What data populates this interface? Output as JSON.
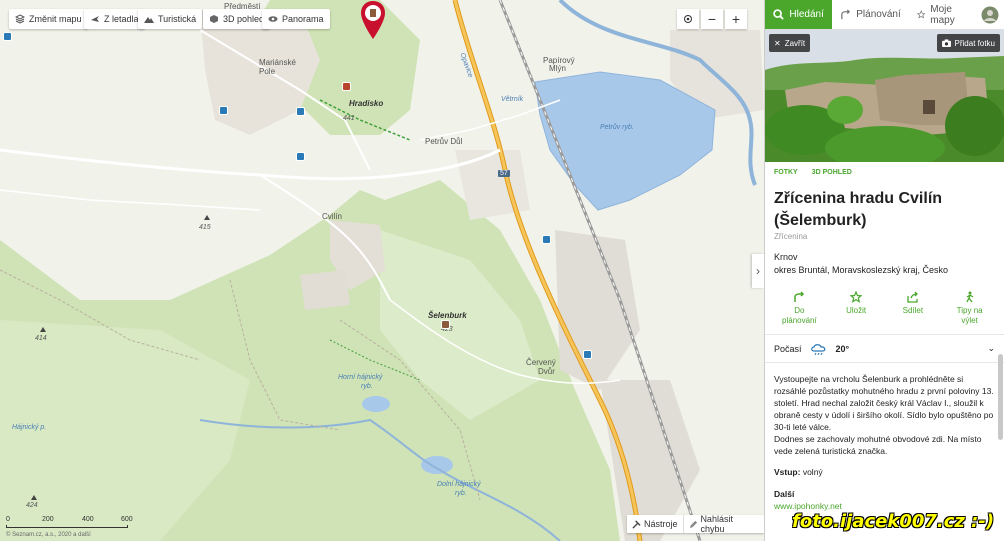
{
  "map": {
    "toolbar": {
      "change_map": "Změnit mapu",
      "from_plane": "Z letadla",
      "tourist": "Turistická",
      "view3d": "3D pohled",
      "panorama": "Panorama"
    },
    "zoom": {
      "minus": "−",
      "plus": "+"
    },
    "labels": {
      "predmesti": "Předměstí",
      "marianske": "Mariánské",
      "pole": "Pole",
      "hradisko": "Hradisko",
      "petruv_dul": "Petrův Důl",
      "cvilin": "Cvilín",
      "selenburk": "Šelenburk",
      "cerveny": "Červený",
      "dvur": "Dvůr",
      "papirovy": "Papírový",
      "mlyn": "Mlýn",
      "vetrnik": "Větrník",
      "opavice": "Opavice",
      "petruv_ryb": "Petrův ryb.",
      "horni_hajnicky": "Horní hájnický",
      "ryb1": "ryb.",
      "dolni_hajnicky": "Dolní hájnický",
      "ryb2": "ryb.",
      "hajnicky_p": "Hájnický p.",
      "road57": "57"
    },
    "elevations": {
      "e441": "441",
      "e415": "415",
      "e414": "414",
      "e423": "423",
      "e424": "424"
    },
    "bottom_tools": {
      "tools": "Nástroje",
      "report": "Nahlásit chybu"
    },
    "scale": {
      "t0": "0",
      "t200": "200",
      "t400": "400",
      "t600": "600"
    },
    "copyright": "© Seznam.cz, a.s., 2020 a další",
    "watermark": "foto.ijacek007.cz :-)"
  },
  "panel": {
    "tabs": {
      "search": "Hledání",
      "plan": "Plánování",
      "mymaps": "Moje mapy"
    },
    "photo": {
      "close": "Zavřít",
      "add_photo": "Přidat fotku"
    },
    "photo_tabs": {
      "photos": "FOTKY",
      "view3d": "3D POHLED"
    },
    "title": "Zřícenina hradu Cvilín (Šelemburk)",
    "subtitle": "Zřícenina",
    "address_line1": "Krnov",
    "address_line2": "okres Bruntál, Moravskoslezský kraj, Česko",
    "actions": {
      "plan_line1": "Do",
      "plan_line2": "plánování",
      "save": "Uložit",
      "share": "Sdílet",
      "tips_line1": "Tipy na",
      "tips_line2": "výlet"
    },
    "weather": {
      "label": "Počasí",
      "temp": "20°"
    },
    "description": "Vystoupejte na vrcholu Šelenburk a prohlédněte si rozsáhlé pozůstatky mohutného hradu z první poloviny 13. století. Hrad nechal založit český král Václav I., sloužil k obraně cesty v údolí i širšího okolí. Sídlo bylo opuštěno po 30-ti leté válce.",
    "description2": "Dodnes se zachovaly mohutné obvodové zdi. Na místo vede zelená turistická značka.",
    "vstup_label": "Vstup:",
    "vstup_value": "volný",
    "dalsi": "Další",
    "link": "www.ipohonky.net"
  },
  "colors": {
    "accent_green": "#4aa72c",
    "forest": "#c9e0b0",
    "water": "#a8c8ea",
    "highway": "#f3b53a",
    "pin_red": "#c8102e"
  }
}
